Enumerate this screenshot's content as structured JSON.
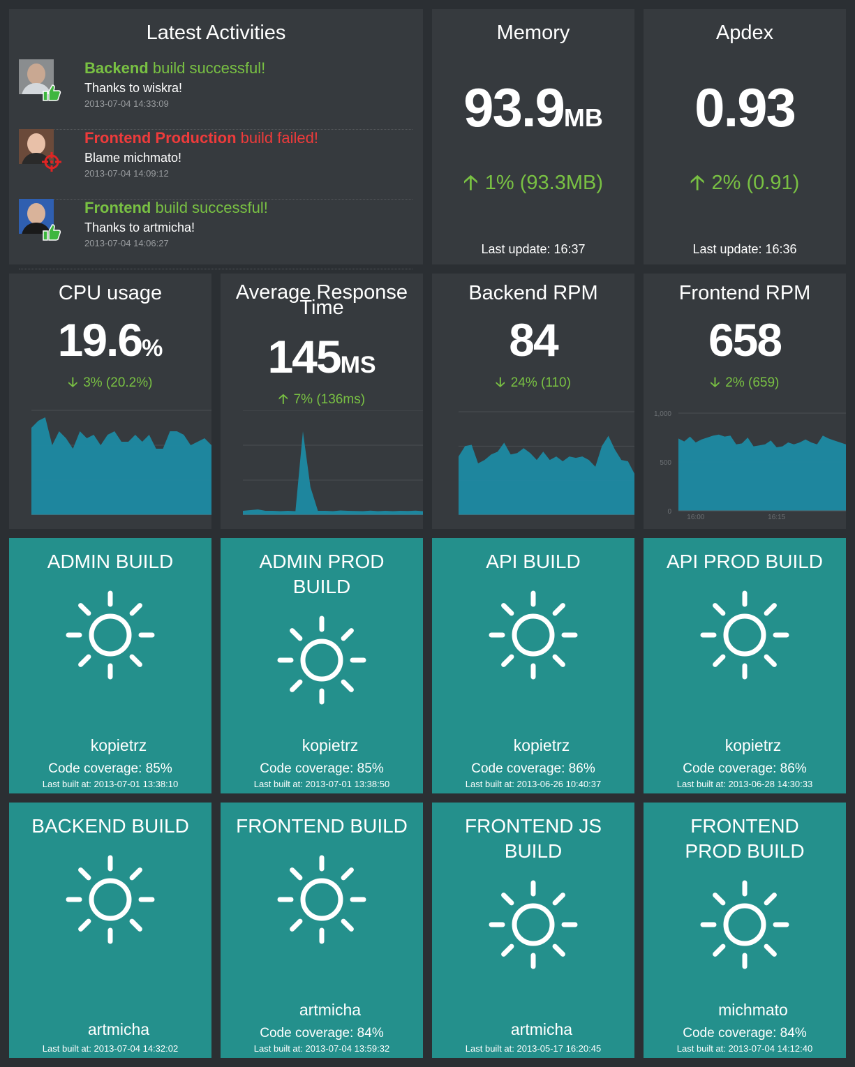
{
  "activities": {
    "title": "Latest Activities",
    "items": [
      {
        "project": "Backend",
        "status_text": "build successful!",
        "message": "Thanks to wiskra!",
        "time": "2013-07-04 14:33:09",
        "status": "success"
      },
      {
        "project": "Frontend Production",
        "status_text": "build failed!",
        "message": "Blame michmato!",
        "time": "2013-07-04 14:09:12",
        "status": "failed"
      },
      {
        "project": "Frontend",
        "status_text": "build successful!",
        "message": "Thanks to artmicha!",
        "time": "2013-07-04 14:06:27",
        "status": "success"
      }
    ]
  },
  "memory": {
    "title": "Memory",
    "value": "93.9",
    "unit": "MB",
    "change": "1% (93.3MB)",
    "direction": "up",
    "last_update": "Last update: 16:37"
  },
  "apdex": {
    "title": "Apdex",
    "value": "0.93",
    "change": "2% (0.91)",
    "direction": "up",
    "last_update": "Last update: 16:36"
  },
  "cpu": {
    "title": "CPU usage",
    "value": "19.6",
    "unit": "%",
    "change": "3% (20.2%)",
    "direction": "down"
  },
  "response": {
    "title_line1": "Average Response",
    "title_line2": "Time",
    "value": "145",
    "unit": "MS",
    "change": "7% (136ms)",
    "direction": "up"
  },
  "backend_rpm": {
    "title": "Backend RPM",
    "value": "84",
    "change": "24% (110)",
    "direction": "down"
  },
  "frontend_rpm": {
    "title": "Frontend RPM",
    "value": "658",
    "change": "2% (659)",
    "direction": "down"
  },
  "builds": [
    {
      "title": "ADMIN BUILD",
      "user": "kopietrz",
      "coverage": "Code coverage: 85%",
      "last_built": "Last built at: 2013-07-01 13:38:10"
    },
    {
      "title": "ADMIN PROD BUILD",
      "user": "kopietrz",
      "coverage": "Code coverage: 85%",
      "last_built": "Last built at: 2013-07-01 13:38:50"
    },
    {
      "title": "API BUILD",
      "user": "kopietrz",
      "coverage": "Code coverage: 86%",
      "last_built": "Last built at: 2013-06-26 10:40:37"
    },
    {
      "title": "API PROD BUILD",
      "user": "kopietrz",
      "coverage": "Code coverage: 86%",
      "last_built": "Last built at: 2013-06-28 14:30:33"
    },
    {
      "title": "BACKEND BUILD",
      "user": "artmicha",
      "coverage": "",
      "last_built": "Last built at: 2013-07-04 14:32:02"
    },
    {
      "title": "FRONTEND BUILD",
      "user": "artmicha",
      "coverage": "Code coverage: 84%",
      "last_built": "Last built at: 2013-07-04 13:59:32"
    },
    {
      "title": "FRONTEND JS BUILD",
      "user": "artmicha",
      "coverage": "",
      "last_built": "Last built at: 2013-05-17 16:20:45"
    },
    {
      "title": "FRONTEND PROD BUILD",
      "user": "michmato",
      "coverage": "Code coverage: 84%",
      "last_built": "Last built at: 2013-07-04 14:12:40"
    }
  ],
  "colors": {
    "background": "#2b2f33",
    "widget": "#363a3e",
    "build_ok": "#24908c",
    "positive": "#79c143",
    "negative": "#ee3b3b",
    "chart_fill": "#1e8aa3"
  },
  "chart_data": [
    {
      "type": "area",
      "title": "CPU usage",
      "ylim": [
        0,
        30
      ],
      "values": [
        25,
        27,
        28,
        20,
        24,
        22,
        19,
        24,
        22,
        23,
        20,
        23,
        24,
        21,
        21,
        23,
        21,
        23,
        19,
        19,
        24,
        24,
        23,
        20,
        21,
        22,
        20
      ]
    },
    {
      "type": "area",
      "title": "Average Response Time",
      "ylim": [
        0,
        1500
      ],
      "values": [
        60,
        70,
        80,
        60,
        60,
        55,
        60,
        55,
        1200,
        400,
        60,
        60,
        55,
        65,
        60,
        58,
        55,
        62,
        55,
        60,
        55,
        60,
        58,
        62,
        55
      ]
    },
    {
      "type": "area",
      "title": "Backend RPM",
      "ylim": [
        0,
        150
      ],
      "values": [
        85,
        100,
        102,
        75,
        80,
        88,
        92,
        105,
        88,
        90,
        97,
        90,
        80,
        92,
        80,
        85,
        78,
        85,
        83,
        85,
        80,
        70,
        100,
        115,
        95,
        80,
        78,
        60
      ]
    },
    {
      "type": "area",
      "title": "Frontend RPM",
      "ylim": [
        0,
        1000
      ],
      "y_ticks": [
        "1,000",
        "500",
        "0"
      ],
      "x_ticks": [
        "16:00",
        "16:15"
      ],
      "values": [
        740,
        710,
        760,
        700,
        730,
        750,
        770,
        780,
        760,
        770,
        680,
        690,
        750,
        660,
        670,
        680,
        720,
        650,
        660,
        700,
        680,
        700,
        730,
        700,
        680,
        770,
        740,
        720,
        700,
        680
      ]
    }
  ]
}
